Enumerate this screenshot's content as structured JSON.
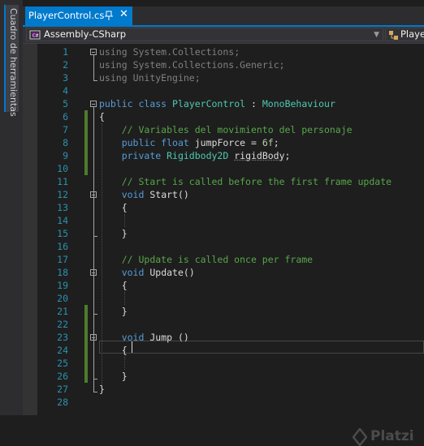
{
  "toolbox": {
    "label": "Cuadro de herramientas"
  },
  "tab": {
    "filename": "PlayerControl.cs",
    "close_icon": "close-icon",
    "pin_icon": "pin-icon"
  },
  "navbar": {
    "project": "Assembly-CSharp",
    "type": "PlayerControl"
  },
  "editor": {
    "line_numbers": [
      "1",
      "2",
      "3",
      "4",
      "5",
      "6",
      "7",
      "8",
      "9",
      "10",
      "11",
      "12",
      "13",
      "14",
      "15",
      "16",
      "17",
      "18",
      "19",
      "20",
      "21",
      "22",
      "23",
      "24",
      "25",
      "26",
      "27",
      "28"
    ],
    "code_lines": [
      "using System.Collections;",
      "using System.Collections.Generic;",
      "using UnityEngine;",
      "",
      "public class PlayerControl : MonoBehaviour",
      "{",
      "    // Variables del movimiento del personaje",
      "    public float jumpForce = 6f;",
      "    private Rigidbody2D rigidBody;",
      "",
      "    // Start is called before the first frame update",
      "    void Start()",
      "    {",
      "",
      "    }",
      "",
      "    // Update is called once per frame",
      "    void Update()",
      "    {",
      "",
      "    }",
      "",
      "    void Jump ()",
      "    {",
      "",
      "    }",
      "}",
      ""
    ],
    "caret_line": 24
  },
  "colors": {
    "keyword": "#569cd6",
    "type": "#4ec9b0",
    "comment": "#57a64a",
    "number": "#b5cea8",
    "line_number": "#2b91af",
    "accent": "#007acc",
    "change_marker": "#4f7b2c"
  },
  "watermark": {
    "text": "Platzi"
  }
}
